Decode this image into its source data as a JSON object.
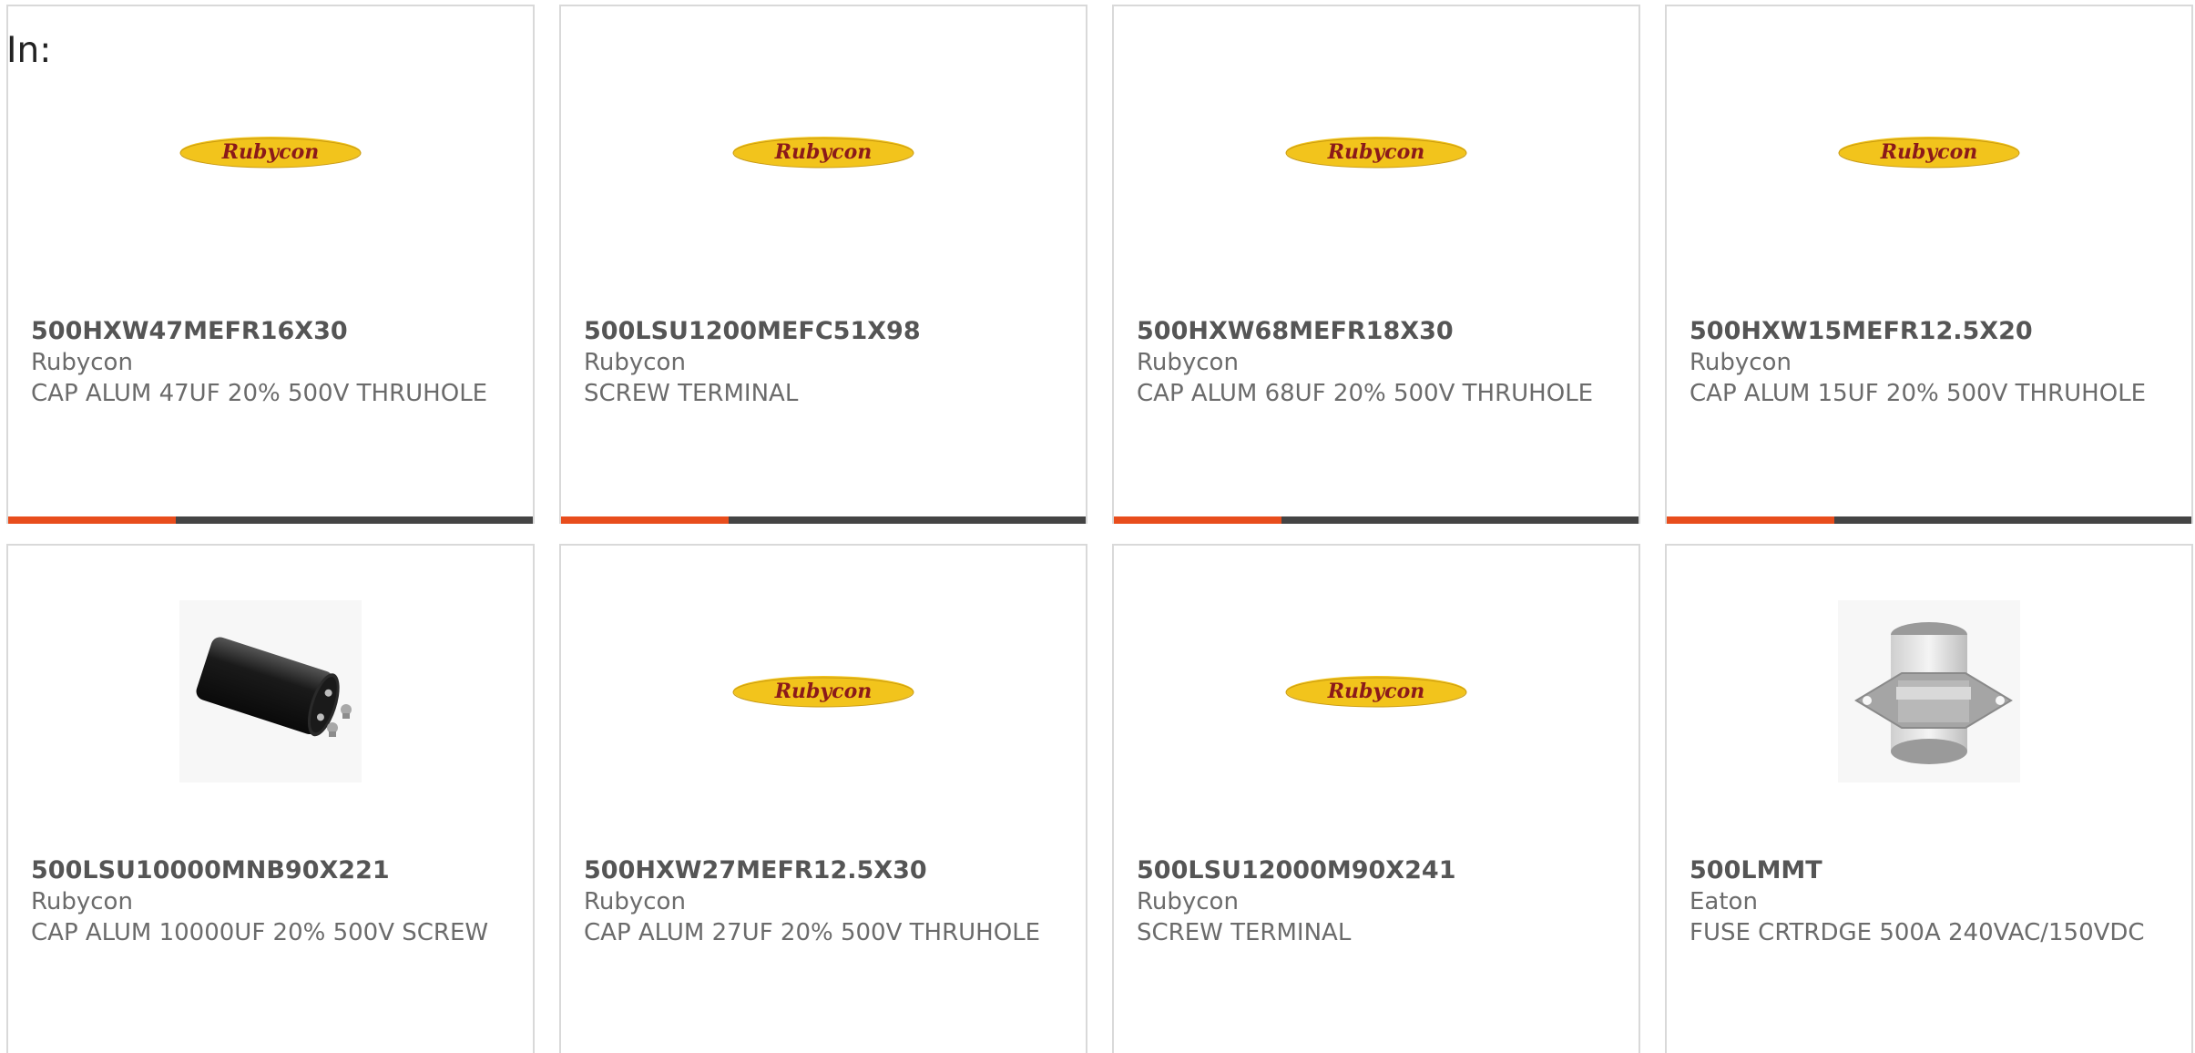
{
  "filter": {
    "label": "In:"
  },
  "colors": {
    "accent": "#e84d1c",
    "bar_track": "#444444",
    "logo_yellow": "#f2c41c",
    "logo_text": "#8b1a1a"
  },
  "products": [
    {
      "part_number": "500HXW47MEFR16X30",
      "manufacturer": "Rubycon",
      "description": "CAP ALUM 47UF 20% 500V THRUHOLE",
      "image": "rubycon-logo",
      "logo_text": "Rubycon",
      "progress": 0.32
    },
    {
      "part_number": "500LSU1200MEFC51X98",
      "manufacturer": "Rubycon",
      "description": "SCREW TERMINAL",
      "image": "rubycon-logo",
      "logo_text": "Rubycon",
      "progress": 0.32
    },
    {
      "part_number": "500HXW68MEFR18X30",
      "manufacturer": "Rubycon",
      "description": "CAP ALUM 68UF 20% 500V THRUHOLE",
      "image": "rubycon-logo",
      "logo_text": "Rubycon",
      "progress": 0.32
    },
    {
      "part_number": "500HXW15MEFR12.5X20",
      "manufacturer": "Rubycon",
      "description": "CAP ALUM 15UF 20% 500V THRUHOLE",
      "image": "rubycon-logo",
      "logo_text": "Rubycon",
      "progress": 0.32
    },
    {
      "part_number": "500LSU10000MNB90X221",
      "manufacturer": "Rubycon",
      "description": "CAP ALUM 10000UF 20% 500V SCREW",
      "image": "capacitor-photo"
    },
    {
      "part_number": "500HXW27MEFR12.5X30",
      "manufacturer": "Rubycon",
      "description": "CAP ALUM 27UF 20% 500V THRUHOLE",
      "image": "rubycon-logo",
      "logo_text": "Rubycon"
    },
    {
      "part_number": "500LSU12000M90X241",
      "manufacturer": "Rubycon",
      "description": "SCREW TERMINAL",
      "image": "rubycon-logo",
      "logo_text": "Rubycon"
    },
    {
      "part_number": "500LMMT",
      "manufacturer": "Eaton",
      "description": "FUSE CRTRDGE 500A 240VAC/150VDC",
      "image": "fuse-photo"
    }
  ]
}
